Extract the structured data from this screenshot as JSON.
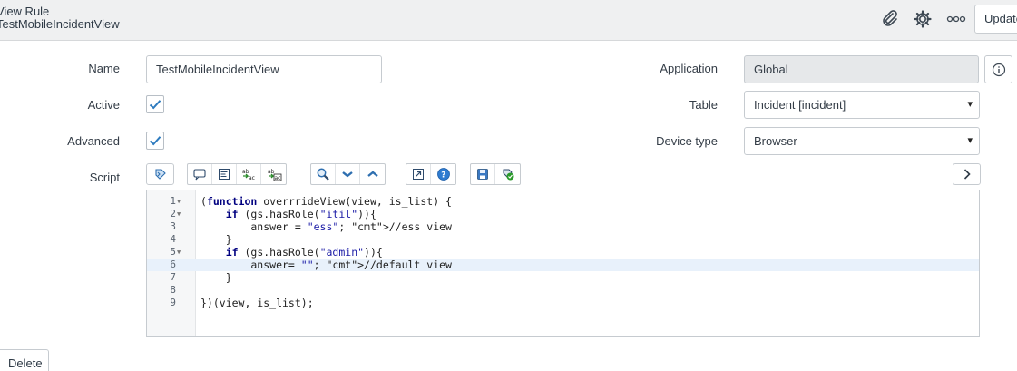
{
  "header": {
    "title_line1": "View Rule",
    "title_line2": "TestMobileIncidentView",
    "update_label": "Update",
    "icons": [
      "paperclip-icon",
      "gear-icon",
      "more-icon"
    ]
  },
  "form": {
    "name_label": "Name",
    "name_value": "TestMobileIncidentView",
    "active_label": "Active",
    "active_checked": true,
    "advanced_label": "Advanced",
    "advanced_checked": true,
    "script_label": "Script",
    "application_label": "Application",
    "application_value": "Global",
    "table_label": "Table",
    "table_value": "Incident [incident]",
    "device_type_label": "Device type",
    "device_type_value": "Browser"
  },
  "editor": {
    "line_numbers": [
      "1",
      "2",
      "3",
      "4",
      "5",
      "6",
      "7",
      "8",
      "9"
    ],
    "active_line": 6,
    "lines": [
      "(function overrrideView(view, is_list) {",
      "    if (gs.hasRole(\"itil\")){",
      "        answer = \"ess\"; //ess view",
      "    }",
      "    if (gs.hasRole(\"admin\")){",
      "        answer= \"\"; //default view",
      "    }",
      "",
      "})(view, is_list);"
    ]
  },
  "toolbar": {
    "icons": [
      "toggle-syntax-icon",
      "comment-icon",
      "format-icon",
      "replace-icon",
      "replace-all-icon",
      "search-icon",
      "fold-icon",
      "unfold-icon",
      "fullscreen-icon",
      "help-icon",
      "save-icon",
      "check-syntax-icon",
      "expand-right-icon"
    ]
  },
  "footer": {
    "delete_label": "Delete"
  }
}
